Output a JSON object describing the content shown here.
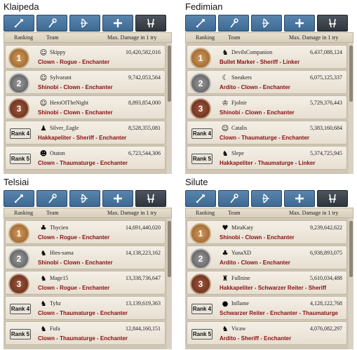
{
  "header": {
    "ranking": "Ranking",
    "team": "Team",
    "max_damage": "Max. Damage in 1 try"
  },
  "rank4_label": "Rank 4",
  "rank5_label": "Rank 5",
  "colors": {
    "tab": "#4a77a0",
    "tab_active": "#3a4048",
    "class_text": "#8a0f12"
  },
  "quadrants": [
    {
      "server": "Klaipeda",
      "rows": [
        {
          "rank": "1",
          "avatar": "☺",
          "name": "Skippy",
          "damage": "10,420,582,016",
          "classes": "Clown - Rogue - Enchanter"
        },
        {
          "rank": "2",
          "avatar": "☺",
          "name": "Sylvarant",
          "damage": "9,742,053,564",
          "classes": "Shinobi - Clown - Enchanter"
        },
        {
          "rank": "3",
          "avatar": "☺",
          "name": "HeroOfTheNight",
          "damage": "8,893,854,000",
          "classes": "Shinobi - Clown - Enchanter"
        },
        {
          "rank": "4",
          "avatar": "♟",
          "name": "Silver_Eagle",
          "damage": "8,528,355,081",
          "classes": "Hakkapeliter - Sheriff - Enchanter"
        },
        {
          "rank": "5",
          "avatar": "☻",
          "name": "Otaton",
          "damage": "6,723,544,306",
          "classes": "Clown - Thaumaturge - Enchanter"
        }
      ]
    },
    {
      "server": "Fedimian",
      "rows": [
        {
          "rank": "1",
          "avatar": "♞",
          "name": "DevilsCompanion",
          "damage": "6,437,088,124",
          "classes": "Bullet Marker - Sheriff - Linker"
        },
        {
          "rank": "2",
          "avatar": "☾",
          "name": "Sneakers",
          "damage": "6,075,125,337",
          "classes": "Ardito - Clown - Enchanter"
        },
        {
          "rank": "3",
          "avatar": "♔",
          "name": "Fjolnir",
          "damage": "5,729,376,443",
          "classes": "Shinobi - Clown - Enchanter"
        },
        {
          "rank": "4",
          "avatar": "☺",
          "name": "Catalis",
          "damage": "5,383,160,684",
          "classes": "Clown - Thaumaturge - Enchanter"
        },
        {
          "rank": "5",
          "avatar": "♞",
          "name": "Slepe",
          "damage": "5,374,725,945",
          "classes": "Hakkapeliter - Thaumaturge - Linker"
        }
      ]
    },
    {
      "server": "Telsiai",
      "rows": [
        {
          "rank": "1",
          "avatar": "♣",
          "name": "Thycien",
          "damage": "14,691,440,020",
          "classes": "Clown - Rogue - Enchanter"
        },
        {
          "rank": "2",
          "avatar": "♞",
          "name": "Hies-sama",
          "damage": "14,138,223,162",
          "classes": "Shinobi - Clown - Enchanter"
        },
        {
          "rank": "3",
          "avatar": "♞",
          "name": "Mage15",
          "damage": "13,338,736,647",
          "classes": "Clown - Rogue - Enchanter"
        },
        {
          "rank": "4",
          "avatar": "♞",
          "name": "Tyhz",
          "damage": "13,139,619,363",
          "classes": "Clown - Thaumaturge - Enchanter"
        },
        {
          "rank": "5",
          "avatar": "♞",
          "name": "Fufa",
          "damage": "12,844,160,151",
          "classes": "Clown - Thaumaturge - Enchanter"
        }
      ]
    },
    {
      "server": "Silute",
      "rows": [
        {
          "rank": "1",
          "avatar": "♥",
          "name": "MiraKaty",
          "damage": "9,239,642,622",
          "classes": "Shinobi - Clown - Enchanter"
        },
        {
          "rank": "2",
          "avatar": "♣",
          "name": "YunaXD",
          "damage": "6,938,893,075",
          "classes": "Ardito - Clown - Enchanter"
        },
        {
          "rank": "3",
          "avatar": "♜",
          "name": "Fullnine",
          "damage": "5,610,034,488",
          "classes": "Hakkapeliter - Schwarzer Reiter - Sheriff"
        },
        {
          "rank": "4",
          "avatar": "●",
          "name": "Inflame",
          "damage": "4,128,122,768",
          "classes": "Schwarzer Reiter - Enchanter - Thaumaturge"
        },
        {
          "rank": "5",
          "avatar": "♞",
          "name": "Vicaw",
          "damage": "4,076,082,297",
          "classes": "Ardito - Sheriff - Enchanter"
        }
      ]
    }
  ]
}
